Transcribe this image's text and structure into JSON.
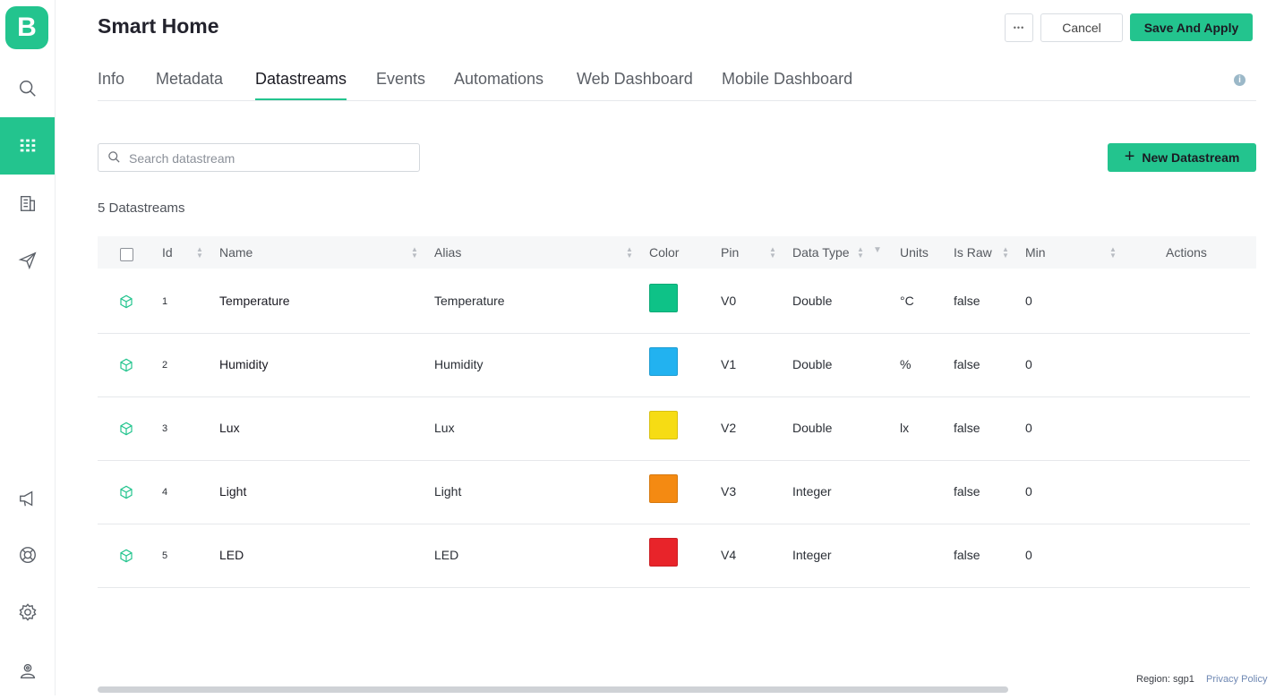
{
  "app": {
    "logo_letter": "B",
    "accent": "#23c48e"
  },
  "sidebar": {
    "top_items": [
      {
        "icon": "search-icon"
      },
      {
        "icon": "grid-icon",
        "active": true
      },
      {
        "icon": "building-icon"
      },
      {
        "icon": "send-icon"
      }
    ],
    "bottom_items": [
      {
        "icon": "megaphone-icon"
      },
      {
        "icon": "lifebuoy-icon"
      },
      {
        "icon": "gear-icon"
      },
      {
        "icon": "user-badge-icon"
      }
    ]
  },
  "header": {
    "title": "Smart Home",
    "more_label": "•••",
    "cancel_label": "Cancel",
    "save_label": "Save And Apply"
  },
  "tabs": [
    {
      "label": "Info"
    },
    {
      "label": "Metadata"
    },
    {
      "label": "Datastreams",
      "active": true
    },
    {
      "label": "Events"
    },
    {
      "label": "Automations"
    },
    {
      "label": "Web Dashboard"
    },
    {
      "label": "Mobile Dashboard"
    }
  ],
  "toolbar": {
    "search_placeholder": "Search datastream",
    "new_button_label": "New Datastream",
    "count_label": "5 Datastreams"
  },
  "table": {
    "headers": {
      "id": "Id",
      "name": "Name",
      "alias": "Alias",
      "color": "Color",
      "pin": "Pin",
      "data_type": "Data Type",
      "units": "Units",
      "is_raw": "Is Raw",
      "min": "Min",
      "actions": "Actions"
    },
    "rows": [
      {
        "id": "1",
        "name": "Temperature",
        "alias": "Temperature",
        "color": "#0ec287",
        "pin": "V0",
        "data_type": "Double",
        "units": "°C",
        "is_raw": "false",
        "min": "0"
      },
      {
        "id": "2",
        "name": "Humidity",
        "alias": "Humidity",
        "color": "#22b2f0",
        "pin": "V1",
        "data_type": "Double",
        "units": "%",
        "is_raw": "false",
        "min": "0"
      },
      {
        "id": "3",
        "name": "Lux",
        "alias": "Lux",
        "color": "#f6dc14",
        "pin": "V2",
        "data_type": "Double",
        "units": "lx",
        "is_raw": "false",
        "min": "0"
      },
      {
        "id": "4",
        "name": "Light",
        "alias": "Light",
        "color": "#f48a12",
        "pin": "V3",
        "data_type": "Integer",
        "units": "",
        "is_raw": "false",
        "min": "0"
      },
      {
        "id": "5",
        "name": "LED",
        "alias": "LED",
        "color": "#e8242a",
        "pin": "V4",
        "data_type": "Integer",
        "units": "",
        "is_raw": "false",
        "min": "0"
      }
    ]
  },
  "footer": {
    "region": "Region: sgp1",
    "privacy": "Privacy Policy"
  }
}
